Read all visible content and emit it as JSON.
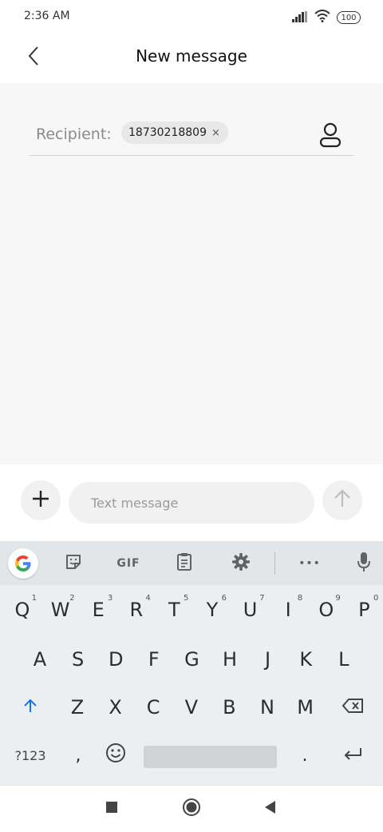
{
  "status_bar": {
    "time": "2:36 AM",
    "battery": "100",
    "icons": [
      "signal-icon",
      "wifi-icon",
      "battery-icon"
    ]
  },
  "header": {
    "title": "New message",
    "back_icon": "chevron-left-icon"
  },
  "recipient": {
    "label": "Recipient:",
    "chip_value": "18730218809",
    "chip_remove": "×",
    "contact_icon": "person-icon"
  },
  "composer": {
    "placeholder": "Text message",
    "add_icon": "plus-icon",
    "send_icon": "arrow-up-icon"
  },
  "keyboard": {
    "toolbar": {
      "gif_label": "GIF",
      "more_label": "•••",
      "icons": [
        "google-icon",
        "sticker-icon",
        "clipboard-icon",
        "gear-icon",
        "more-icon",
        "mic-icon"
      ]
    },
    "row1": [
      {
        "key": "Q",
        "hint": "1"
      },
      {
        "key": "W",
        "hint": "2"
      },
      {
        "key": "E",
        "hint": "3"
      },
      {
        "key": "R",
        "hint": "4"
      },
      {
        "key": "T",
        "hint": "5"
      },
      {
        "key": "Y",
        "hint": "6"
      },
      {
        "key": "U",
        "hint": "7"
      },
      {
        "key": "I",
        "hint": "8"
      },
      {
        "key": "O",
        "hint": "9"
      },
      {
        "key": "P",
        "hint": "0"
      }
    ],
    "row2": [
      "A",
      "S",
      "D",
      "F",
      "G",
      "H",
      "J",
      "K",
      "L"
    ],
    "row3": [
      "Z",
      "X",
      "C",
      "V",
      "B",
      "N",
      "M"
    ],
    "row4": {
      "symbols": "?123",
      "comma": ",",
      "period": "."
    }
  },
  "nav_bar": {
    "icons": [
      "square-icon",
      "circle-icon",
      "triangle-back-icon"
    ]
  },
  "colors": {
    "accent_shift": "#1a73e8",
    "compose_bg": "#f7f7f7",
    "keyboard_bg": "#eceff1"
  }
}
